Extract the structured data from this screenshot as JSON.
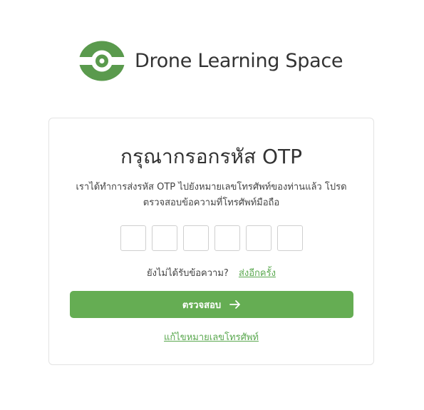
{
  "brand": {
    "name": "Drone Learning Space",
    "logo_icon": "drone-lens-logo-icon",
    "color": "#5a9a4d"
  },
  "card": {
    "title": "กรุณากรอกรหัส OTP",
    "message_line1": "เราได้ทำการส่งรหัส OTP ไปยังหมายเลขโทรศัพท์ของท่านแล้ว โปรด",
    "message_line2": "ตรวจสอบข้อความที่โทรศัพท์มือถือ",
    "otp_digits": [
      "",
      "",
      "",
      "",
      "",
      ""
    ],
    "resend_prompt": "ยังไม่ได้รับข้อความ?",
    "resend_link": "ส่งอีกครั้ง",
    "verify_button": "ตรวจสอบ",
    "verify_icon": "arrow-right-icon",
    "change_phone_link": "แก้ไขหมายเลขโทรศัพท์"
  },
  "colors": {
    "accent": "#65ad53",
    "link": "#5aa84f",
    "text": "#333333"
  }
}
